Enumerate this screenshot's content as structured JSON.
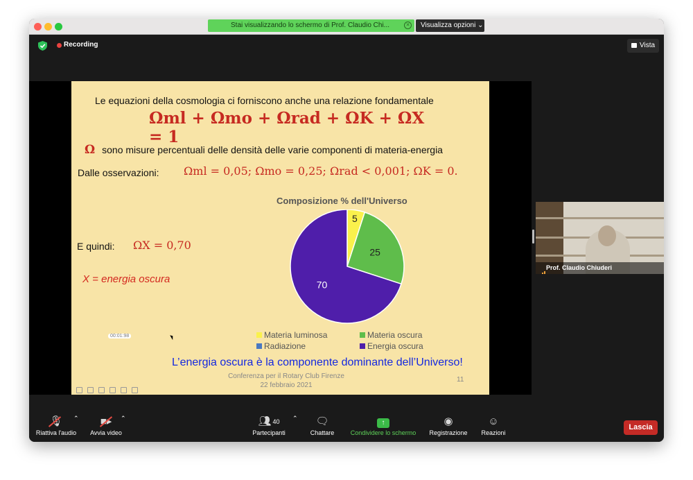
{
  "window": {
    "share_banner": "Stai visualizzando lo schermo di Prof. Claudio Chi...",
    "view_options": "Visualizza opzioni ⌄",
    "recording": "Recording",
    "view_button": "Vista"
  },
  "slide": {
    "title": "Le equazioni della cosmologia ci forniscono anche una relazione fondamentale",
    "main_equation": "Ωml + Ωmo + Ωrad + ΩK + ΩX = 1",
    "omega_symbol": "Ω",
    "omega_description": "sono misure percentuali delle densità delle varie componenti di materia-energia",
    "observations_label": "Dalle osservazioni:",
    "observations_values": "Ωml = 0,05;   Ωmo = 0,25;   Ωrad < 0,001;   ΩK = 0.",
    "quindi_label": "E quindi:",
    "quindi_value": "ΩX = 0,70",
    "x_definition": "X = energia oscura",
    "conclusion": "L’energia oscura è la componente dominante dell’Universo!",
    "footer_line1": "Conferenza per il Rotary Club Firenze",
    "footer_line2": "22 febbraio 2021",
    "page_number": "11",
    "timer": "00:01:98"
  },
  "chart_data": {
    "type": "pie",
    "title": "Composizione  % dell'Universo",
    "slices": [
      {
        "name": "Materia luminosa",
        "value": 5,
        "color": "#faf14c",
        "label": "5"
      },
      {
        "name": "Materia oscura",
        "value": 25,
        "color": "#5fbd4b",
        "label": "25"
      },
      {
        "name": "Radiazione",
        "value": 0,
        "color": "#4a78c0",
        "label": ""
      },
      {
        "name": "Energia oscura",
        "value": 70,
        "color": "#4f1eaa",
        "label": "70"
      }
    ],
    "legend_position": "bottom"
  },
  "video": {
    "participant_name": "Prof. Claudio Chiuderi"
  },
  "toolbar": {
    "audio": "Riattiva l'audio",
    "video": "Avvia video",
    "participants": "Partecipanti",
    "participants_count": "40",
    "chat": "Chattare",
    "share": "Condividere lo schermo",
    "record": "Registrazione",
    "reactions": "Reazioni",
    "leave": "Lascia"
  },
  "colors": {
    "slide_bg": "#f8e4a7",
    "formula_red": "#c62a21",
    "conclusion_blue": "#1428e0",
    "share_green": "#5fd35a",
    "leave_red": "#c42b26"
  }
}
